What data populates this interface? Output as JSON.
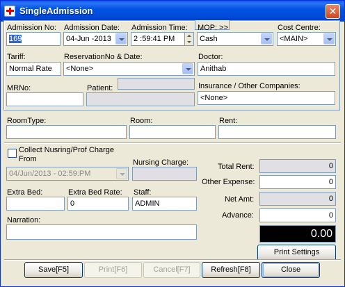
{
  "window": {
    "title": "SingleAdmission",
    "close_glyph": "✕"
  },
  "top": {
    "admission_no_label": "Admission No:",
    "admission_no_value": "169",
    "admission_date_label": "Admission Date:",
    "admission_date_value": "04-Jun -2013",
    "admission_time_label": "Admission Time:",
    "admission_time_value": "2 :59:41 PM",
    "mop_label": "MOP: >>",
    "mop_value": "Cash",
    "cost_centre_label": "Cost Centre:",
    "cost_centre_value": "<MAIN>",
    "tariff_label": "Tariff:",
    "tariff_value": "Normal Rate",
    "reservation_label": "ReservationNo & Date:",
    "reservation_value": "<None>",
    "doctor_label": "Doctor:",
    "doctor_value": "Anithab",
    "mrno_label": "MRNo:",
    "mrno_value": "",
    "patient_label": "Patient:",
    "patient_value": "",
    "insurance_label": "Insurance / Other Companies:",
    "insurance_value": "<None>"
  },
  "room": {
    "room_type_label": "RoomType:",
    "room_label": "Room:",
    "rent_label": "Rent:",
    "collect_label_1": "Collect Nusring/Prof Charge",
    "collect_label_2": "From",
    "collect_checked": false,
    "from_datetime": "04/Jun/2013 - 02:59:PM",
    "nursing_charge_label": "Nursing Charge:",
    "extra_bed_label": "Extra Bed:",
    "extra_bed_rate_label": "Extra Bed Rate:",
    "extra_bed_rate_value": "0",
    "staff_label": "Staff:",
    "staff_value": "ADMIN",
    "narration_label": "Narration:"
  },
  "totals": {
    "total_rent_label": "Total Rent:",
    "total_rent_value": "0",
    "other_expense_label": "Other Expense:",
    "other_expense_value": "0",
    "net_amt_label": "Net Amt:",
    "net_amt_value": "0",
    "advance_label": "Advance:",
    "advance_value": "0",
    "display_value": "0.00"
  },
  "buttons": {
    "print_settings": "Print Settings",
    "save": "Save[F5]",
    "print": "Print[F6]",
    "cancel": "Cancel[F7]",
    "refresh": "Refresh[F8]",
    "close": "Close"
  }
}
